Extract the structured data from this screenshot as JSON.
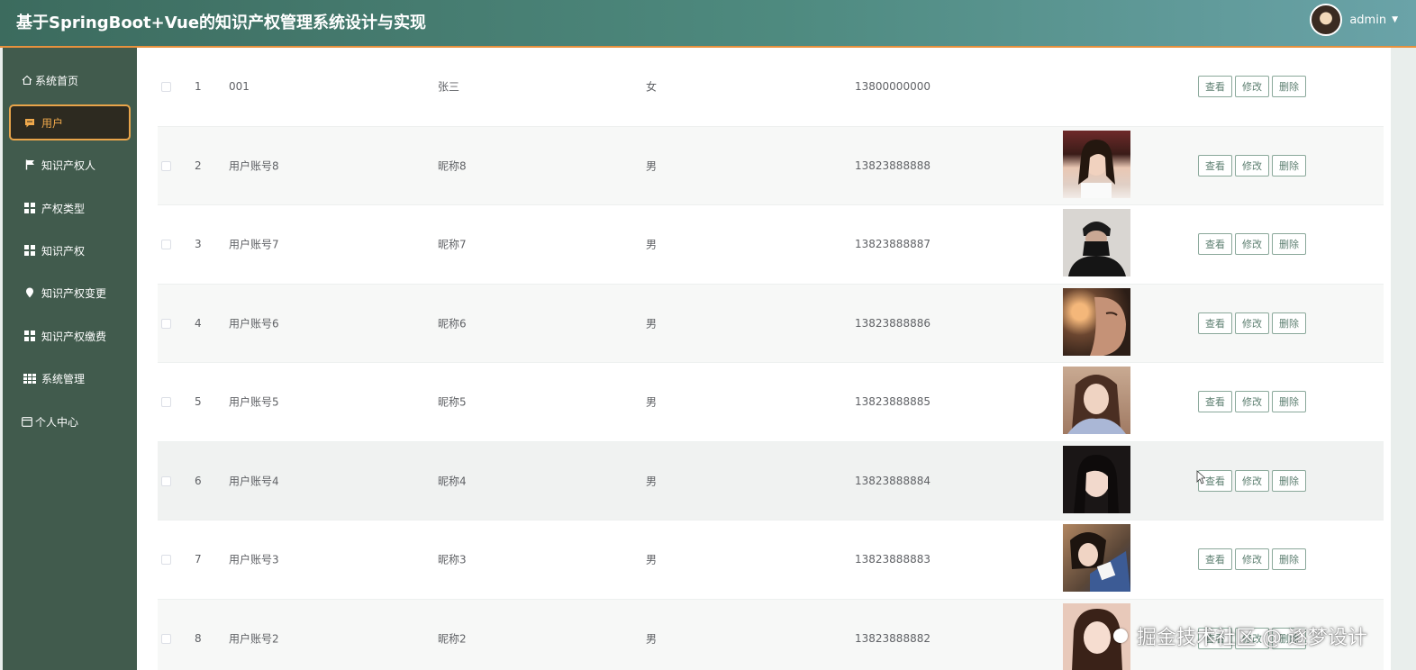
{
  "header": {
    "title": "基于SpringBoot+Vue的知识产权管理系统设计与实现",
    "user_name": "admin",
    "caret_icon": "caret-down-icon",
    "accent_color": "#e8913d"
  },
  "sidebar": {
    "items": [
      {
        "label": "系统首页",
        "icon": "home-icon"
      },
      {
        "label": "用户",
        "icon": "chat-icon",
        "active": true
      },
      {
        "label": "知识产权人",
        "icon": "flag-icon"
      },
      {
        "label": "产权类型",
        "icon": "grid-icon"
      },
      {
        "label": "知识产权",
        "icon": "grid-icon"
      },
      {
        "label": "知识产权变更",
        "icon": "location-pin-icon"
      },
      {
        "label": "知识产权缴费",
        "icon": "grid-icon"
      },
      {
        "label": "系统管理",
        "icon": "list-grid-icon"
      },
      {
        "label": "个人中心",
        "icon": "card-icon"
      }
    ],
    "active_color": "#f0a94c"
  },
  "table": {
    "rows": [
      {
        "index": "1",
        "account": "001",
        "nickname": "张三",
        "sex": "女",
        "phone": "13800000000",
        "photo": ""
      },
      {
        "index": "2",
        "account": "用户账号8",
        "nickname": "昵称8",
        "sex": "男",
        "phone": "13823888888",
        "photo": "portrait-photo"
      },
      {
        "index": "3",
        "account": "用户账号7",
        "nickname": "昵称7",
        "sex": "男",
        "phone": "13823888887",
        "photo": "portrait-photo"
      },
      {
        "index": "4",
        "account": "用户账号6",
        "nickname": "昵称6",
        "sex": "男",
        "phone": "13823888886",
        "photo": "portrait-photo"
      },
      {
        "index": "5",
        "account": "用户账号5",
        "nickname": "昵称5",
        "sex": "男",
        "phone": "13823888885",
        "photo": "portrait-photo"
      },
      {
        "index": "6",
        "account": "用户账号4",
        "nickname": "昵称4",
        "sex": "男",
        "phone": "13823888884",
        "photo": "portrait-photo"
      },
      {
        "index": "7",
        "account": "用户账号3",
        "nickname": "昵称3",
        "sex": "男",
        "phone": "13823888883",
        "photo": "portrait-photo"
      },
      {
        "index": "8",
        "account": "用户账号2",
        "nickname": "昵称2",
        "sex": "男",
        "phone": "13823888882",
        "photo": "portrait-photo"
      }
    ],
    "actions": {
      "view": "查看",
      "edit": "修改",
      "delete": "删除"
    }
  },
  "watermark": "掘金技术社区 @ 逐梦设计"
}
